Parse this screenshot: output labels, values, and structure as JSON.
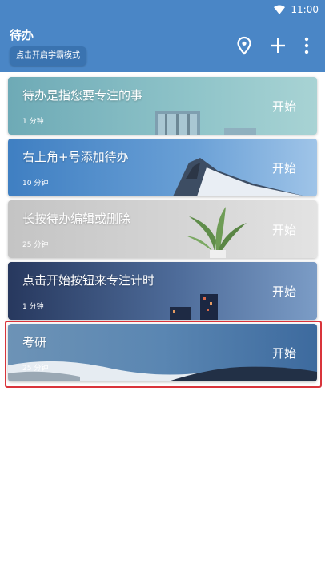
{
  "status_bar": {
    "time": "11:00"
  },
  "app_bar": {
    "title": "待办",
    "mode_button": "点击开启学霸模式"
  },
  "todos": [
    {
      "label": "待办是指您要专注的事",
      "duration": "1 分钟",
      "action": "开始"
    },
    {
      "label": "右上角+号添加待办",
      "duration": "10 分钟",
      "action": "开始"
    },
    {
      "label": "长按待办编辑或删除",
      "duration": "25 分钟",
      "action": "开始"
    },
    {
      "label": "点击开始按钮来专注计时",
      "duration": "1 分钟",
      "action": "开始"
    },
    {
      "label": "考研",
      "duration": "25 分钟",
      "action": "开始"
    }
  ]
}
